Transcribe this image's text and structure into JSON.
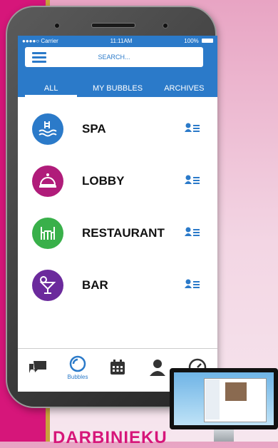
{
  "status": {
    "carrier": "●●●●○ Carrier",
    "time": "11:11AM",
    "battery": "100%"
  },
  "search": {
    "placeholder": "SEARCH..."
  },
  "tabs": [
    {
      "label": "ALL",
      "active": true
    },
    {
      "label": "MY BUBBLES",
      "active": false
    },
    {
      "label": "ARCHIVES",
      "active": false
    }
  ],
  "bubbles": [
    {
      "label": "SPA",
      "icon": "spa-icon",
      "color": "#2b7ac9"
    },
    {
      "label": "LOBBY",
      "icon": "bell-icon",
      "color": "#b01c7a"
    },
    {
      "label": "RESTAURANT",
      "icon": "restaurant-icon",
      "color": "#39b04a"
    },
    {
      "label": "BAR",
      "icon": "cocktail-icon",
      "color": "#6b2a9c"
    }
  ],
  "nav": [
    {
      "label": "",
      "icon": "chat-icon"
    },
    {
      "label": "Bubbles",
      "icon": "bubbles-icon"
    },
    {
      "label": "",
      "icon": "calendar-icon"
    },
    {
      "label": "",
      "icon": "user-icon"
    },
    {
      "label": "",
      "icon": "dashboard-icon"
    }
  ],
  "colors": {
    "accent": "#2b7ac9",
    "magenta": "#d6167a",
    "gold": "#c9a23c"
  },
  "footer": {
    "text": "DARBINIEKU"
  }
}
